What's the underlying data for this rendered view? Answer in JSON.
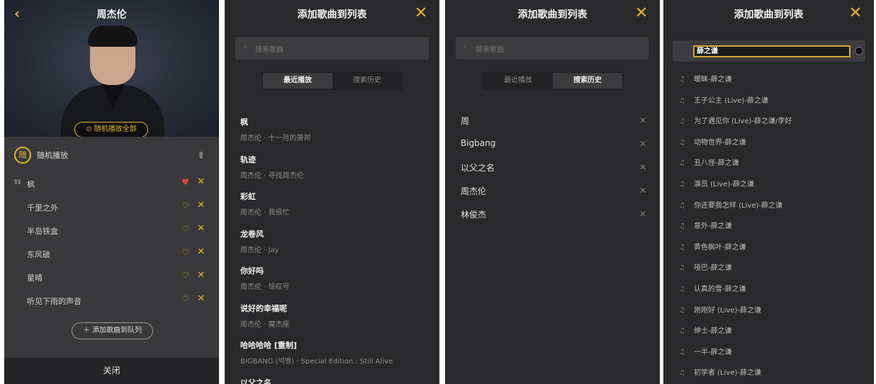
{
  "colors": {
    "accent": "#e3b336",
    "heart": "#e14646",
    "panel": "#29292b"
  },
  "player": {
    "back_icon": "chevron-left-icon",
    "title": "周杰伦",
    "random_button": "随机播放全部",
    "mode_label": "随机播放",
    "songs": [
      {
        "name": "枫",
        "liked": true
      },
      {
        "name": "千里之外",
        "liked": false
      },
      {
        "name": "半岛铁盒",
        "liked": false
      },
      {
        "name": "东风破",
        "liked": false
      },
      {
        "name": "星晴",
        "liked": false
      },
      {
        "name": "听见下雨的声音",
        "liked": false
      }
    ],
    "add_button": "添加歌曲到队列",
    "close": "关闭"
  },
  "add_dialog": {
    "title": "添加歌曲到列表",
    "search_placeholder": "搜索歌曲",
    "tab_recent": "最近播放",
    "tab_history": "搜索历史"
  },
  "recent": [
    {
      "title": "枫",
      "sub": "周杰伦 · 十一月的萧邦"
    },
    {
      "title": "轨迹",
      "sub": "周杰伦 · 寻找周杰伦"
    },
    {
      "title": "彩虹",
      "sub": "周杰伦 · 我很忙"
    },
    {
      "title": "龙卷风",
      "sub": "周杰伦 · Jay"
    },
    {
      "title": "你好吗",
      "sub": "周杰伦 · 惊叹号"
    },
    {
      "title": "说好的幸福呢",
      "sub": "周杰伦 · 魔杰座"
    },
    {
      "title": "哈哈哈哈 [重制]",
      "sub": "BIGBANG (빅뱅) · Special Edition : Still Alive"
    },
    {
      "title": "以父之名",
      "sub": ""
    }
  ],
  "history": [
    "周",
    "Bigbang",
    "以父之名",
    "周杰伦",
    "林俊杰"
  ],
  "query": "薛之谦",
  "suggestions": [
    "暧昧-薛之谦",
    "王子公主 (Live)-薛之谦",
    "为了遇见你 (Live)-薛之谦/李好",
    "动物世界-薛之谦",
    "丑八怪-薛之谦",
    "演员 (Live)-薛之谦",
    "你还要我怎样 (Live)-薛之谦",
    "意外-薛之谦",
    "黄色枫叶-薛之谦",
    "哑巴-薛之谦",
    "认真的雪-薛之谦",
    "刚刚好 (Live)-薛之谦",
    "绅士-薛之谦",
    "一半-薛之谦",
    "初学者 (Live)-薛之谦"
  ]
}
